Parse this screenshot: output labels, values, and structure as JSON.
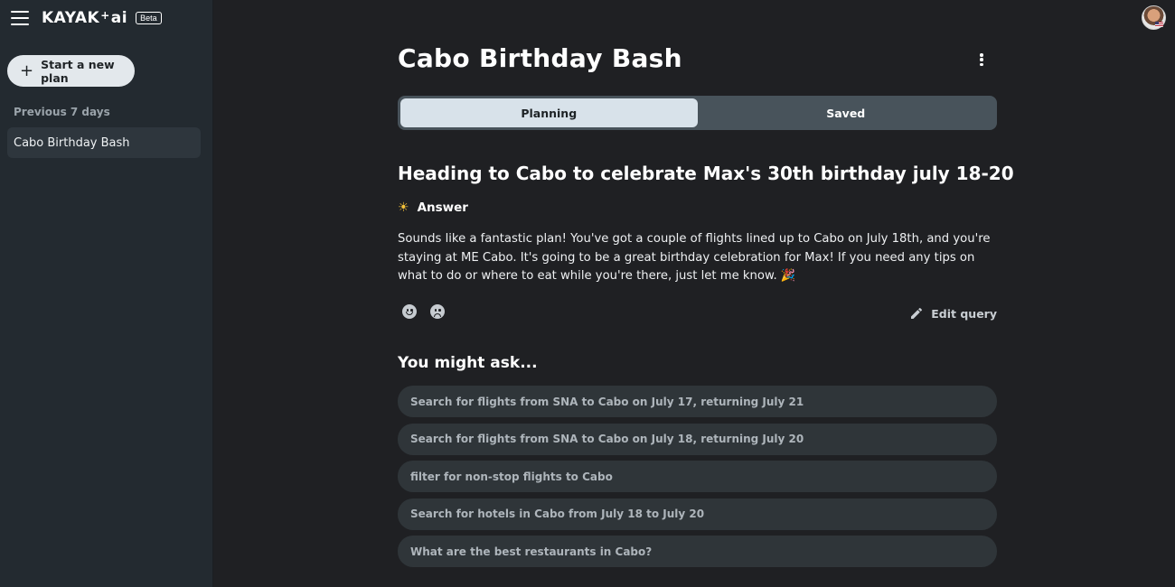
{
  "sidebar": {
    "logo": {
      "brand": "KAYAK",
      "plus": "+",
      "suffix": "ai"
    },
    "badge": "Beta",
    "new_plan": {
      "icon": "plus-icon",
      "plus_glyph": "+",
      "label": "Start a new plan"
    },
    "section_label": "Previous 7 days",
    "items": [
      {
        "label": "Cabo Birthday Bash"
      }
    ]
  },
  "header": {
    "title": "Cabo Birthday Bash",
    "menu_icon": "more-vertical-icon"
  },
  "tabs": [
    {
      "label": "Planning",
      "active": true
    },
    {
      "label": "Saved",
      "active": false
    }
  ],
  "conversation": {
    "query": "Heading to Cabo to celebrate Max's 30th birthday july 18-20",
    "answer_icon": "sun-icon",
    "answer_glyph": "☀",
    "answer_label": "Answer",
    "answer_text": "Sounds like a fantastic plan! You've got a couple of flights lined up to Cabo on July 18th, and you're staying at ME Cabo. It's going to be a great birthday celebration for Max! If you need any tips on what to do or where to eat while you're there, just let me know. 🎉",
    "feedback": {
      "positive_icon": "smile-icon",
      "negative_icon": "frown-icon"
    },
    "edit_query": "Edit query"
  },
  "suggestions": {
    "title": "You might ask...",
    "items": [
      "Search for flights from SNA to Cabo on July 17, returning July 21",
      "Search for flights from SNA to Cabo on July 18, returning July 20",
      "filter for non-stop flights to Cabo",
      "Search for hotels in Cabo from July 18 to July 20",
      "What are the best restaurants in Cabo?"
    ]
  },
  "colors": {
    "sidebar_bg": "#232a30",
    "main_bg": "#1f2023",
    "tab_active_bg": "#d8e2ea",
    "tab_track_bg": "#48535b",
    "suggestion_bg": "#2f3539"
  }
}
